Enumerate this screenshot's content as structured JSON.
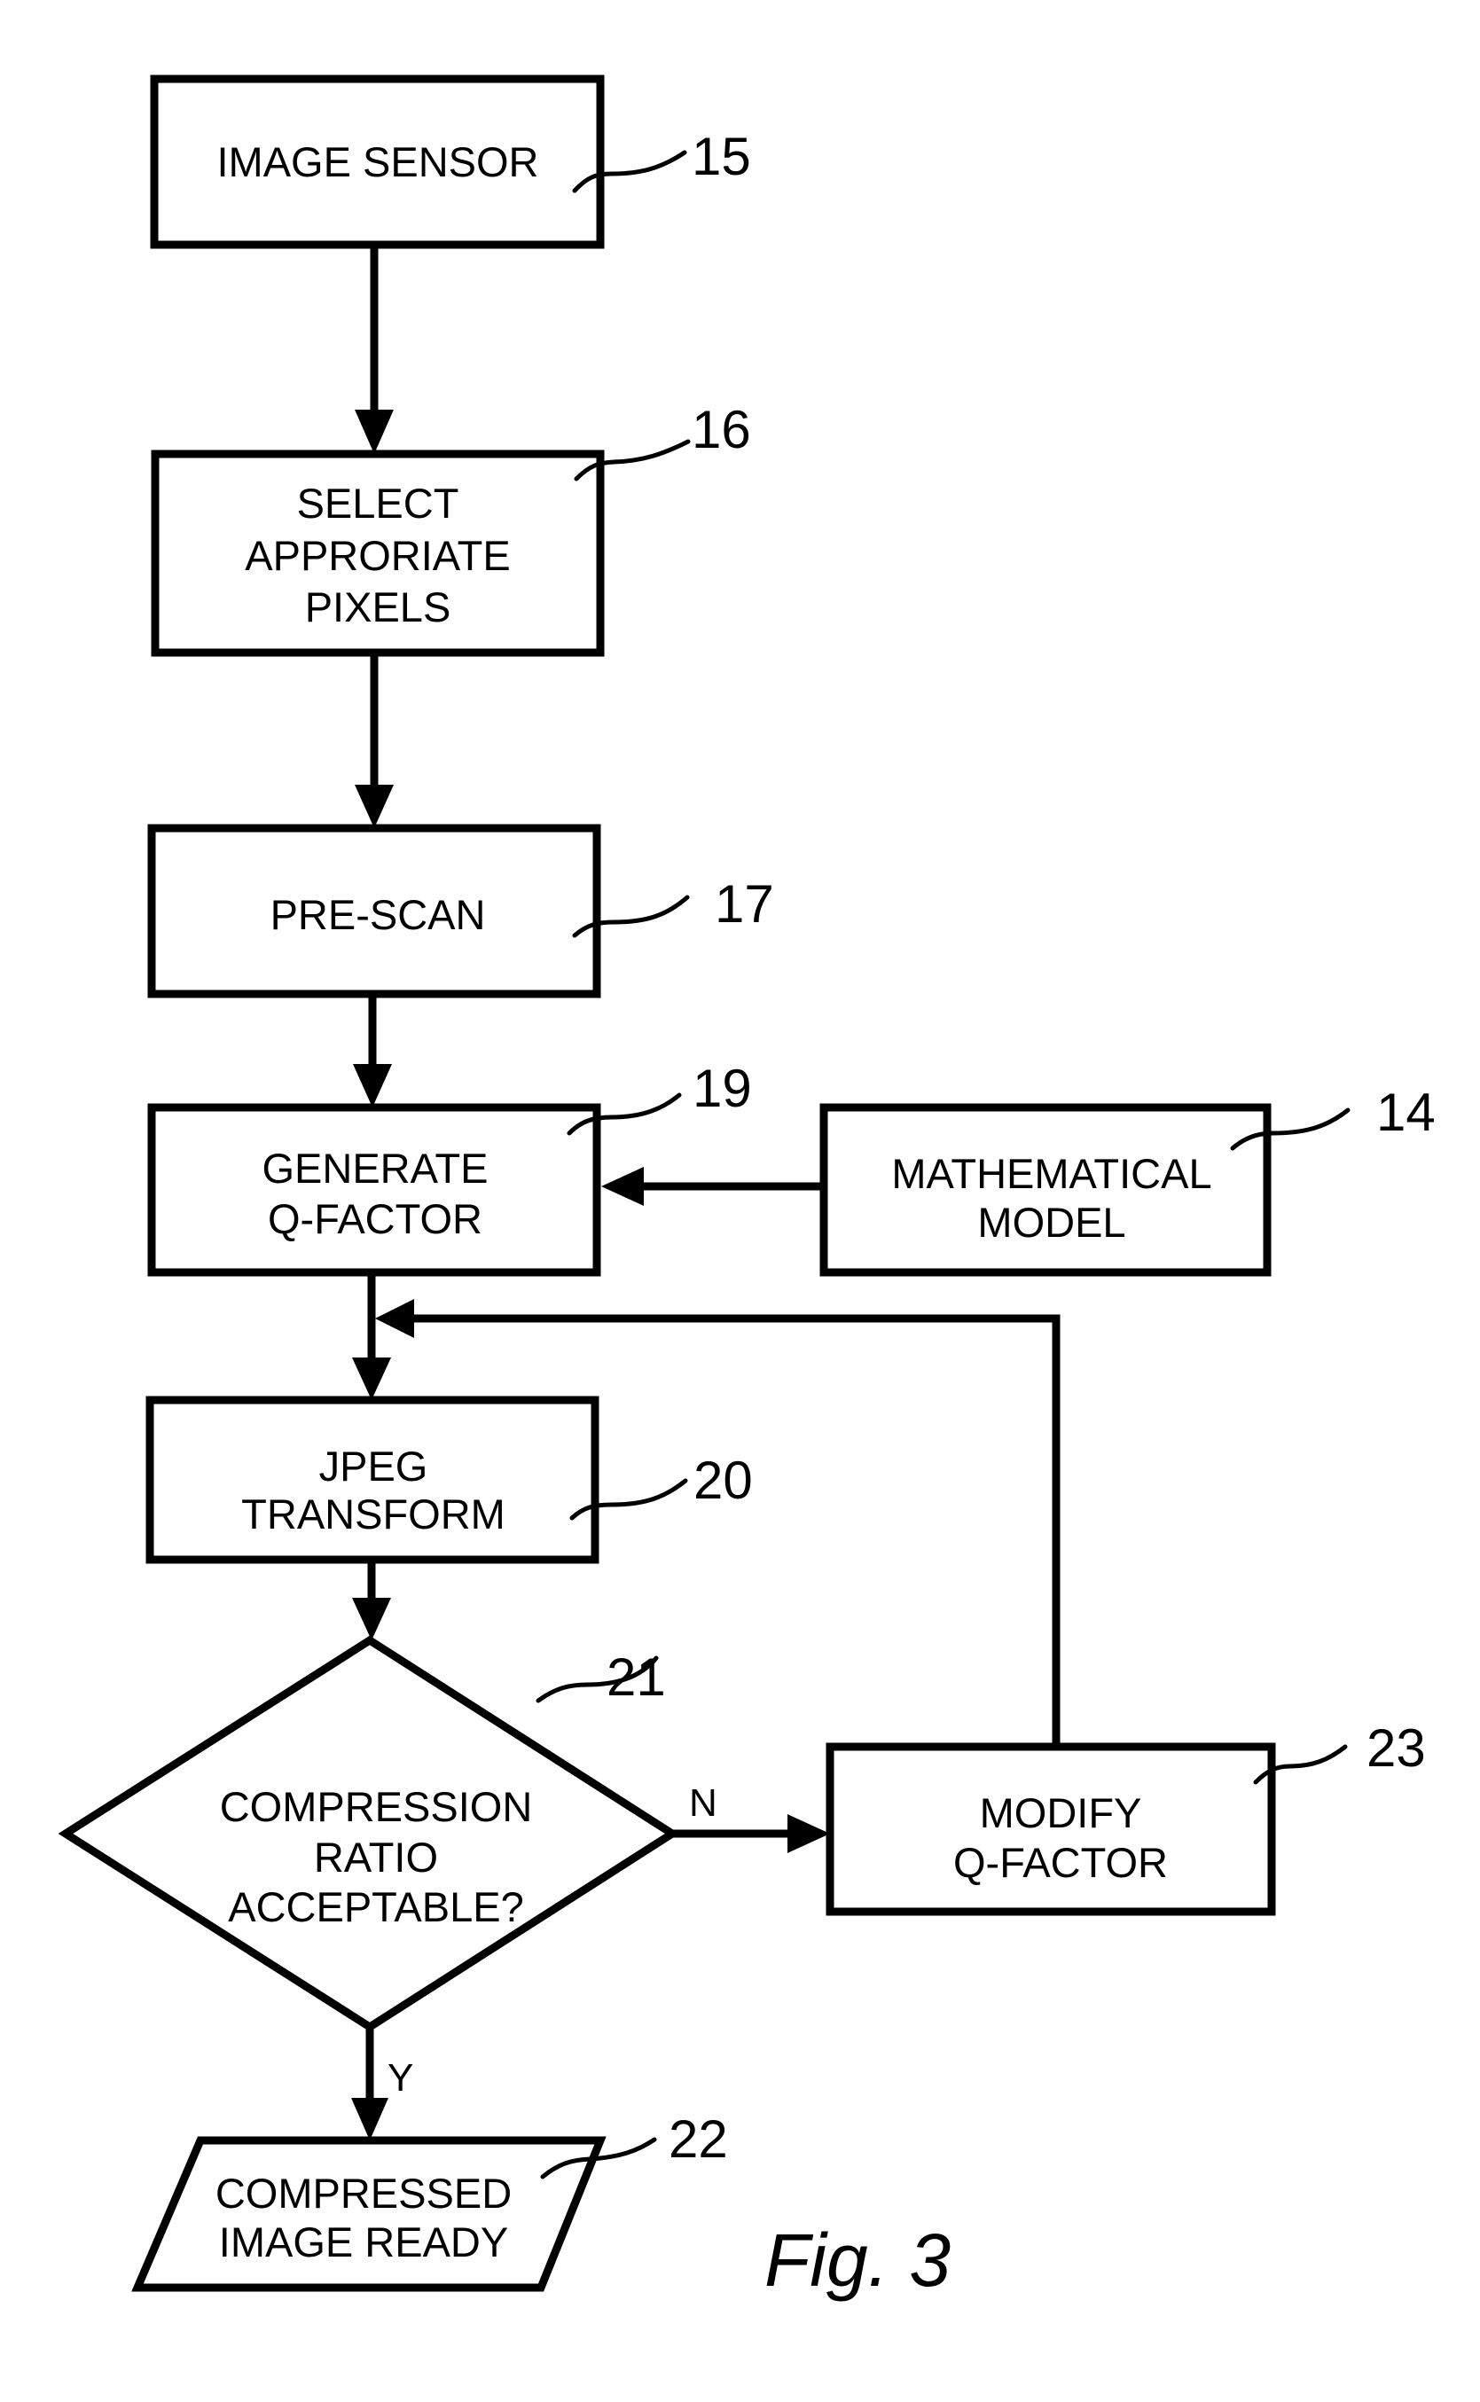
{
  "figure": {
    "caption": "Fig. 3",
    "nodes": [
      {
        "id": "15",
        "type": "process",
        "lines": [
          "IMAGE SENSOR"
        ],
        "ref": "15"
      },
      {
        "id": "16",
        "type": "process",
        "lines": [
          "SELECT",
          "APPRORIATE",
          "PIXELS"
        ],
        "ref": "16"
      },
      {
        "id": "17",
        "type": "process",
        "lines": [
          "PRE-SCAN"
        ],
        "ref": "17"
      },
      {
        "id": "19",
        "type": "process",
        "lines": [
          "GENERATE",
          "Q-FACTOR"
        ],
        "ref": "19"
      },
      {
        "id": "14",
        "type": "process",
        "lines": [
          "MATHEMATICAL",
          "MODEL"
        ],
        "ref": "14"
      },
      {
        "id": "20",
        "type": "process",
        "lines": [
          "JPEG",
          "TRANSFORM"
        ],
        "ref": "20"
      },
      {
        "id": "21",
        "type": "decision",
        "lines": [
          "COMPRESSION",
          "RATIO",
          "ACCEPTABLE?"
        ],
        "ref": "21"
      },
      {
        "id": "23",
        "type": "process",
        "lines": [
          "MODIFY",
          "Q-FACTOR"
        ],
        "ref": "23"
      },
      {
        "id": "22",
        "type": "output",
        "lines": [
          "COMPRESSED",
          "IMAGE READY"
        ],
        "ref": "22"
      }
    ],
    "edges": [
      {
        "from": "15",
        "to": "16"
      },
      {
        "from": "16",
        "to": "17"
      },
      {
        "from": "17",
        "to": "19"
      },
      {
        "from": "14",
        "to": "19"
      },
      {
        "from": "19",
        "to": "20"
      },
      {
        "from": "20",
        "to": "21"
      },
      {
        "from": "21",
        "to": "23",
        "label": "N"
      },
      {
        "from": "23",
        "to": "20",
        "label": ""
      },
      {
        "from": "21",
        "to": "22",
        "label": "Y"
      }
    ]
  }
}
